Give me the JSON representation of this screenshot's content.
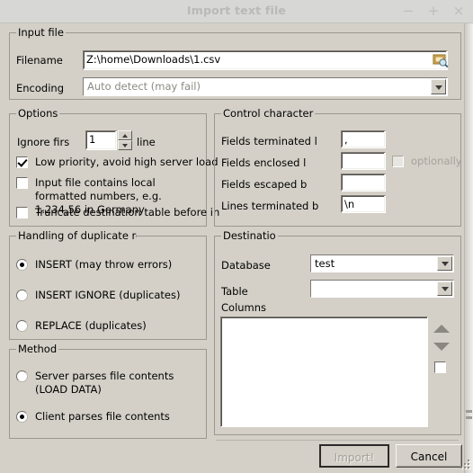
{
  "window": {
    "title": "Import text file",
    "controls": [
      {
        "name": "minimize",
        "glyph": "−"
      },
      {
        "name": "maximize",
        "glyph": "+"
      },
      {
        "name": "close",
        "glyph": "×"
      }
    ]
  },
  "colors": {
    "window_bg": "#d4d0c8",
    "titlebar_bg": "#d7d7d5",
    "title_text": "#b9b9b6",
    "group_border": "#9b988f",
    "field_bg": "#ffffff",
    "disabled_text": "#a5a29b"
  },
  "input_file": {
    "legend": "Input file",
    "filename_label": "Filename",
    "filename_value": "Z:\\home\\Downloads\\1.csv",
    "browse_icon": "folder-search-icon",
    "encoding_label": "Encoding",
    "encoding_value": "Auto detect (may fail)"
  },
  "options": {
    "legend": "Options",
    "ignore_first_label": "Ignore firs",
    "ignore_first_value": "1",
    "line_label": "line",
    "checkboxes": [
      {
        "label": "Low priority, avoid high server load",
        "checked": true
      },
      {
        "label": "Input file contains local formatted numbers, e.g. 1.234,56 in Germany",
        "checked": false
      },
      {
        "label": "Truncate destination table before in",
        "checked": false
      }
    ]
  },
  "control_character": {
    "legend": "Control character",
    "fields": [
      {
        "label": "Fields terminated l",
        "value": ","
      },
      {
        "label": "Fields enclosed l",
        "value": ""
      },
      {
        "label": "Fields escaped b",
        "value": ""
      },
      {
        "label": "Lines terminated b",
        "value": "\\n"
      }
    ],
    "optionally_label": "optionally",
    "optionally_checked": false,
    "optionally_disabled": true
  },
  "duplicates": {
    "legend": "Handling of duplicate ro",
    "options": [
      {
        "label": "INSERT (may throw errors)",
        "selected": true
      },
      {
        "label": "INSERT IGNORE (duplicates)",
        "selected": false
      },
      {
        "label": "REPLACE (duplicates)",
        "selected": false
      }
    ]
  },
  "method": {
    "legend": "Method",
    "options": [
      {
        "label": "Server parses file contents (LOAD DATA)",
        "selected": false
      },
      {
        "label": "Client parses file contents",
        "selected": true
      }
    ]
  },
  "destination": {
    "legend": "Destinatio",
    "database_label": "Database",
    "database_value": "test",
    "table_label": "Table",
    "table_value": "",
    "columns_label": "Columns",
    "columns_items": [],
    "move_up_icon": "triangle-up-icon",
    "move_down_icon": "triangle-down-icon",
    "select_all_checked": false
  },
  "footer": {
    "import_label": "Import!",
    "import_disabled": true,
    "cancel_label": "Cancel"
  }
}
